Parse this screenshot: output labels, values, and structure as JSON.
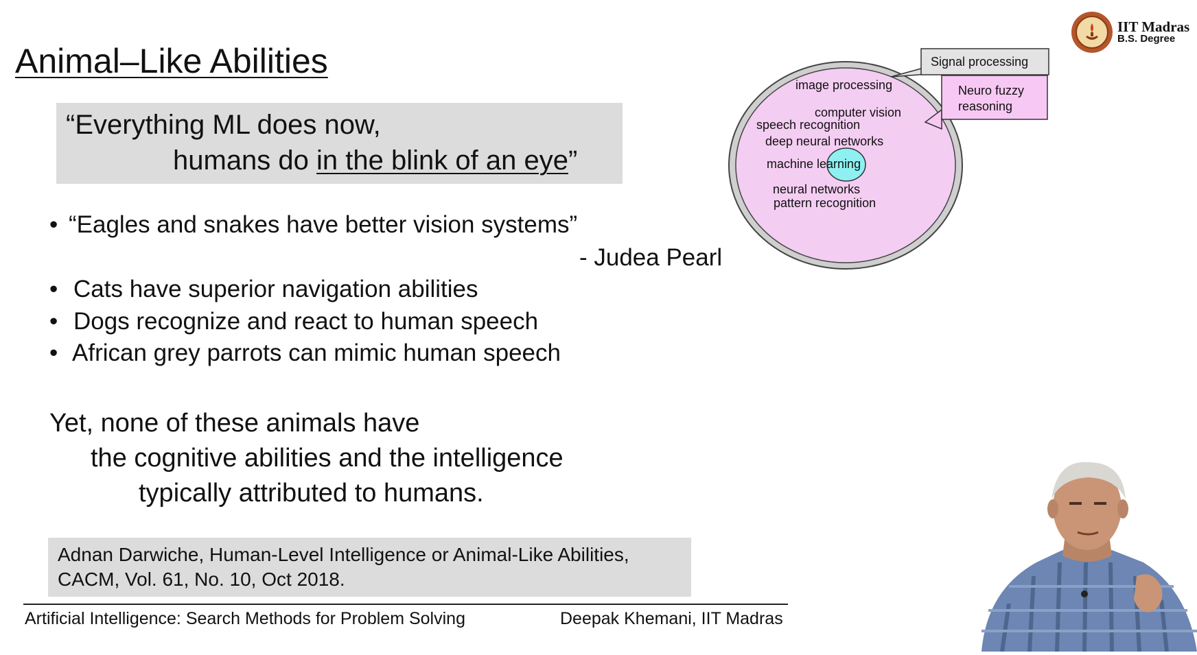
{
  "slide": {
    "title": "Animal–Like  Abilities",
    "quote": {
      "line1": "“Everything ML does now,",
      "line2_prefix": "humans do ",
      "line2_underlined": "in the blink of an eye",
      "line2_suffix": "”"
    },
    "bullets": [
      "“Eagles and snakes have better vision systems”",
      "Cats have superior navigation abilities",
      "Dogs recognize and react to human speech",
      "African grey parrots can mimic human speech"
    ],
    "bullet_symbol": "•",
    "attribution": "- Judea Pearl",
    "conclusion": [
      "Yet, none of these animals have",
      "the cognitive abilities and the intelligence",
      "typically attributed to humans."
    ],
    "reference": [
      "Adnan Darwiche, Human-Level Intelligence or Animal-Like Abilities,",
      "CACM, Vol.  61, No. 10, Oct 2018."
    ]
  },
  "diagram": {
    "labels": {
      "image_processing": "image processing",
      "computer_vision": "computer vision",
      "speech_recognition": "speech recognition",
      "deep_neural_networks": "deep neural networks",
      "machine_learning": "machine learning",
      "neural_networks": "neural networks",
      "pattern_recognition": "pattern recognition"
    },
    "callouts": {
      "signal_processing": "Signal processing",
      "neuro_fuzzy_line1": "Neuro fuzzy",
      "neuro_fuzzy_line2": "reasoning"
    },
    "colors": {
      "outer_ring": "#cfcfcf",
      "inner_fill": "#f4cdf2",
      "ml_fill": "#8ff0f2",
      "callout_signal_fill": "#e3e3e3",
      "callout_neuro_fill": "#f8c8f4"
    }
  },
  "footer": {
    "course": "Artificial Intelligence: Search Methods for Problem Solving",
    "author": "Deepak Khemani, IIT Madras"
  },
  "logo": {
    "name": "IIT Madras",
    "subtitle": "B.S. Degree"
  },
  "presenter": {
    "icon": "presenter-video-icon"
  }
}
